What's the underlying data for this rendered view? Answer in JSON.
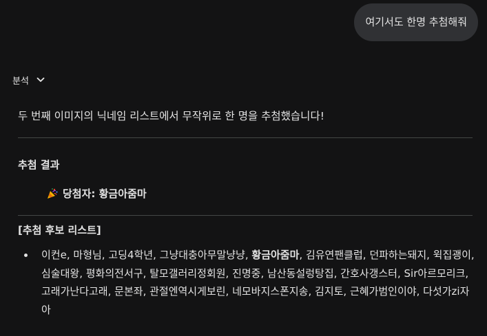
{
  "user_message": "여기서도 한명 추첨해줘",
  "analysis": {
    "label": "분석",
    "icon": "chevron-down-icon"
  },
  "response": {
    "intro": "두 번째 이미지의 닉네임 리스트에서 무작위로 한 명을 추첨했습니다!",
    "result_heading": "추첨 결과",
    "winner_emoji_icon": "party-popper-icon",
    "winner_prefix": "당첨자: ",
    "winner_name": "황금아줌마",
    "candidates_heading": "[추첨 후보 리스트]",
    "candidates": [
      "이컨e",
      "마형님",
      "고딩4학년",
      "그냥대충아무말냥냥",
      "황금아줌마",
      "김유연팬클럽",
      "던파하는돼지",
      "윅집괭이",
      "심술대왕",
      "평화의전서구",
      "탈모갤러리정회원",
      "진명중",
      "남산동설렁탕집",
      "간호사갱스터",
      "Sir아르모리크",
      "고래가난다고래",
      "문본좌",
      "관절엔역시게보린",
      "네모바지스폰지송",
      "김지토",
      "근혜가범인이야",
      "다섯가zi자아"
    ],
    "winner_index": 4
  },
  "colors": {
    "background": "#131314",
    "bubble": "#303134",
    "text": "#e3e3e3",
    "divider": "#444746"
  }
}
